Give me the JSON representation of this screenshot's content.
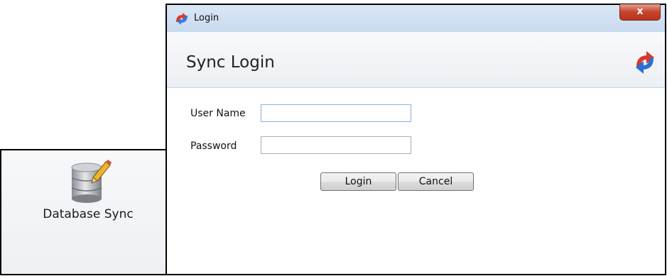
{
  "left_panel": {
    "tile_label": "Database Sync",
    "icon": "database-pencil-icon"
  },
  "window": {
    "title": "Login",
    "close_glyph": "x",
    "header_title": "Sync Login",
    "icons": {
      "app": "sync-arrows-icon",
      "header": "sync-arrows-icon"
    }
  },
  "form": {
    "username_label": "User Name",
    "username_value": "",
    "password_label": "Password",
    "password_value": "",
    "login_button": "Login",
    "cancel_button": "Cancel"
  },
  "colors": {
    "sync_red": "#d83a2a",
    "sync_blue": "#2a6fd8",
    "close_red": "#c5442d",
    "focus_border": "#7eb4ea"
  }
}
